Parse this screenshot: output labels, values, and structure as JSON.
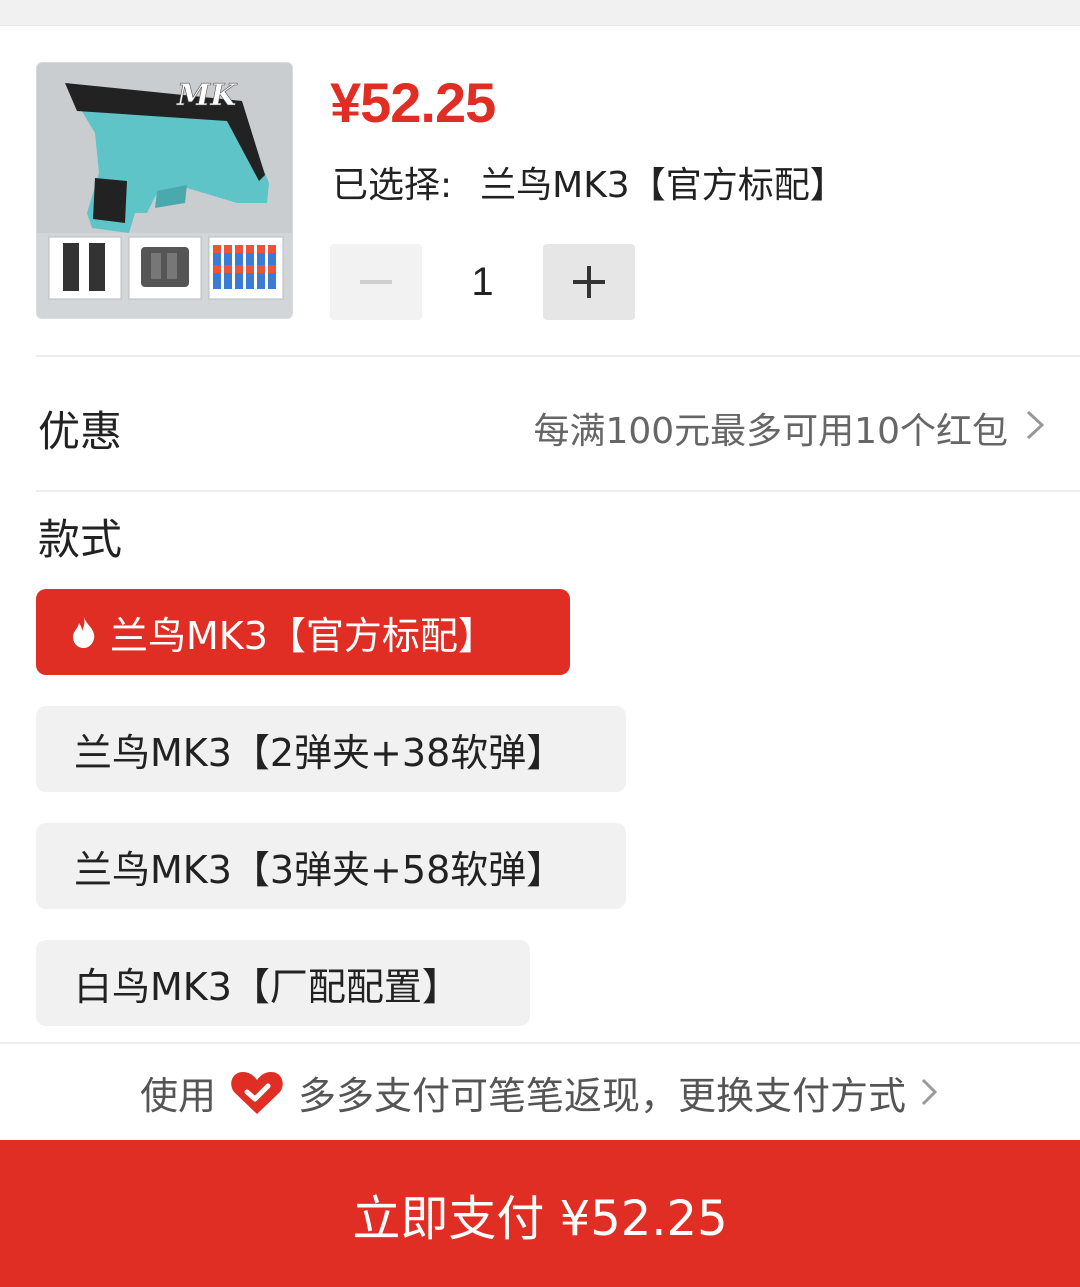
{
  "product": {
    "price": "¥52.25",
    "selected_label": "已选择:",
    "selected_value": "兰鸟MK3【官方标配】",
    "image_icon": "toy-blaster-product-image",
    "quantity": "1"
  },
  "promo": {
    "title": "优惠",
    "value": "每满100元最多可用10个红包"
  },
  "styles": {
    "label": "款式",
    "options": [
      {
        "label": "兰鸟MK3【官方标配】",
        "selected": true
      },
      {
        "label": "兰鸟MK3【2弹夹+38软弹】",
        "selected": false
      },
      {
        "label": "兰鸟MK3【3弹夹+58软弹】",
        "selected": false
      },
      {
        "label": "白鸟MK3【厂配配置】",
        "selected": false
      }
    ]
  },
  "payment_hint": {
    "prefix": "使用",
    "text": "多多支付可笔笔返现，更换支付方式"
  },
  "pay_button": {
    "label": "立即支付 ¥52.25"
  },
  "colors": {
    "accent": "#e02e24",
    "option_bg": "#f1f1f1"
  }
}
